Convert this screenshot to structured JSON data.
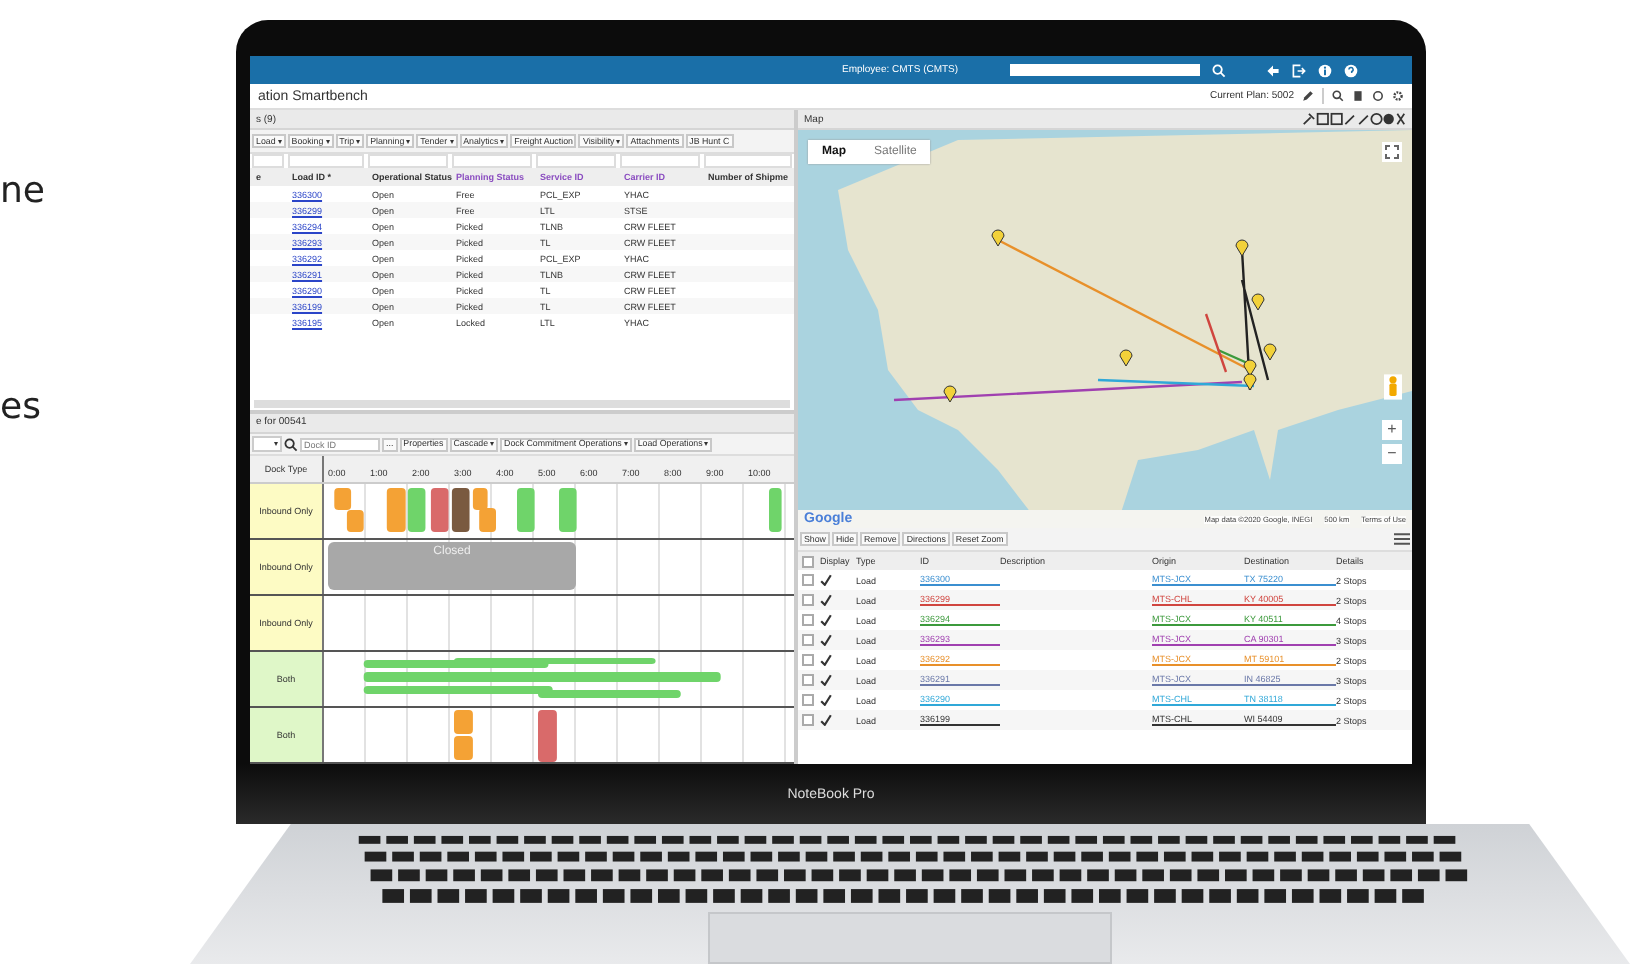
{
  "page_text": [
    "ne",
    "es"
  ],
  "topbar": {
    "employee": "Employee: CMTS (CMTS)"
  },
  "app_title": "ation Smartbench",
  "current_plan": "Current Plan: 5002",
  "loads_panel": {
    "title": "s (9)",
    "toolbar": [
      {
        "label": "Load",
        "dropdown": true
      },
      {
        "label": "Booking",
        "dropdown": true
      },
      {
        "label": "Trip",
        "dropdown": true
      },
      {
        "label": "Planning",
        "dropdown": true
      },
      {
        "label": "Tender",
        "dropdown": true
      },
      {
        "label": "Analytics",
        "dropdown": true
      },
      {
        "label": "Freight Auction",
        "dropdown": false
      },
      {
        "label": "Visibility",
        "dropdown": true
      },
      {
        "label": "Attachments",
        "dropdown": false
      },
      {
        "label": "JB Hunt C",
        "dropdown": false
      }
    ],
    "columns": [
      {
        "label": "e"
      },
      {
        "label": "Load ID *"
      },
      {
        "label": "Operational Status"
      },
      {
        "label": "Planning Status",
        "color": "#8a4cc0"
      },
      {
        "label": "Service ID",
        "color": "#8a4cc0"
      },
      {
        "label": "Carrier ID",
        "color": "#8a4cc0"
      },
      {
        "label": "Number of Shipme"
      }
    ],
    "rows": [
      {
        "load_id": "336300",
        "operational_status": "Open",
        "planning_status": "Free",
        "service_id": "PCL_EXP",
        "carrier_id": "YHAC"
      },
      {
        "load_id": "336299",
        "operational_status": "Open",
        "planning_status": "Free",
        "service_id": "LTL",
        "carrier_id": "STSE"
      },
      {
        "load_id": "336294",
        "operational_status": "Open",
        "planning_status": "Picked",
        "service_id": "TLNB",
        "carrier_id": "CRW FLEET"
      },
      {
        "load_id": "336293",
        "operational_status": "Open",
        "planning_status": "Picked",
        "service_id": "TL",
        "carrier_id": "CRW FLEET"
      },
      {
        "load_id": "336292",
        "operational_status": "Open",
        "planning_status": "Picked",
        "service_id": "PCL_EXP",
        "carrier_id": "YHAC"
      },
      {
        "load_id": "336291",
        "operational_status": "Open",
        "planning_status": "Picked",
        "service_id": "TLNB",
        "carrier_id": "CRW FLEET"
      },
      {
        "load_id": "336290",
        "operational_status": "Open",
        "planning_status": "Picked",
        "service_id": "TL",
        "carrier_id": "CRW FLEET"
      },
      {
        "load_id": "336199",
        "operational_status": "Open",
        "planning_status": "Picked",
        "service_id": "TL",
        "carrier_id": "CRW FLEET"
      },
      {
        "load_id": "336195",
        "operational_status": "Open",
        "planning_status": "Locked",
        "service_id": "LTL",
        "carrier_id": "YHAC"
      }
    ]
  },
  "dock_panel": {
    "title": "e for 00541",
    "dock_id_placeholder": "Dock ID",
    "more": "...",
    "toolbar": [
      {
        "label": "Properties",
        "dropdown": false
      },
      {
        "label": "Cascade",
        "dropdown": true
      },
      {
        "label": "Dock Commitment Operations",
        "dropdown": true
      },
      {
        "label": "Load Operations",
        "dropdown": true
      }
    ],
    "dock_type_header": "Dock Type",
    "hours": [
      "0:00",
      "1:00",
      "2:00",
      "3:00",
      "4:00",
      "5:00",
      "6:00",
      "7:00",
      "8:00",
      "9:00",
      "10:00"
    ],
    "docks": [
      {
        "type": "Inbound Only",
        "kind": "inbound"
      },
      {
        "type": "Inbound Only",
        "kind": "inbound",
        "closed": "Closed"
      },
      {
        "type": "Inbound Only",
        "kind": "inbound"
      },
      {
        "type": "Both",
        "kind": "both"
      },
      {
        "type": "Both",
        "kind": "both"
      }
    ]
  },
  "map_panel": {
    "title": "Map",
    "map_types": [
      {
        "label": "Map",
        "selected": true
      },
      {
        "label": "Satellite",
        "selected": false
      }
    ],
    "zoom_in": "+",
    "zoom_out": "−",
    "logo": "Google",
    "attribution": "Map data ©2020 Google, INEGI",
    "scale": "500 km",
    "terms": "Terms of Use"
  },
  "loads_map_table": {
    "actions": [
      "Show",
      "Hide",
      "Remove",
      "Directions",
      "Reset Zoom"
    ],
    "all_selected": false,
    "columns": [
      "Display",
      "Type",
      "ID",
      "Description",
      "Origin",
      "Destination",
      "Details"
    ],
    "rows": [
      {
        "selected": false,
        "displayed": true,
        "type": "Load",
        "id": "336300",
        "color": "#3b8fd0",
        "origin": "MTS-JCX",
        "destination": "TX 75220",
        "details": "2 Stops"
      },
      {
        "selected": false,
        "displayed": true,
        "type": "Load",
        "id": "336299",
        "color": "#d0453f",
        "origin": "MTS-CHL",
        "destination": "KY 40005",
        "details": "2 Stops"
      },
      {
        "selected": false,
        "displayed": true,
        "type": "Load",
        "id": "336294",
        "color": "#3c9a3c",
        "origin": "MTS-JCX",
        "destination": "KY 40511",
        "details": "4 Stops"
      },
      {
        "selected": false,
        "displayed": true,
        "type": "Load",
        "id": "336293",
        "color": "#a040b0",
        "origin": "MTS-JCX",
        "destination": "CA 90301",
        "details": "3 Stops"
      },
      {
        "selected": false,
        "displayed": true,
        "type": "Load",
        "id": "336292",
        "color": "#e8902a",
        "origin": "MTS-JCX",
        "destination": "MT 59101",
        "details": "2 Stops"
      },
      {
        "selected": false,
        "displayed": true,
        "type": "Load",
        "id": "336291",
        "color": "#6a78a8",
        "origin": "MTS-JCX",
        "destination": "IN 46825",
        "details": "3 Stops"
      },
      {
        "selected": false,
        "displayed": true,
        "type": "Load",
        "id": "336290",
        "color": "#30a8d8",
        "origin": "MTS-CHL",
        "destination": "TN 38118",
        "details": "2 Stops"
      },
      {
        "selected": false,
        "displayed": true,
        "type": "Load",
        "id": "336199",
        "color": "#333333",
        "origin": "MTS-CHL",
        "destination": "WI 54409",
        "details": "2 Stops"
      }
    ]
  },
  "device_label": "NoteBook Pro"
}
